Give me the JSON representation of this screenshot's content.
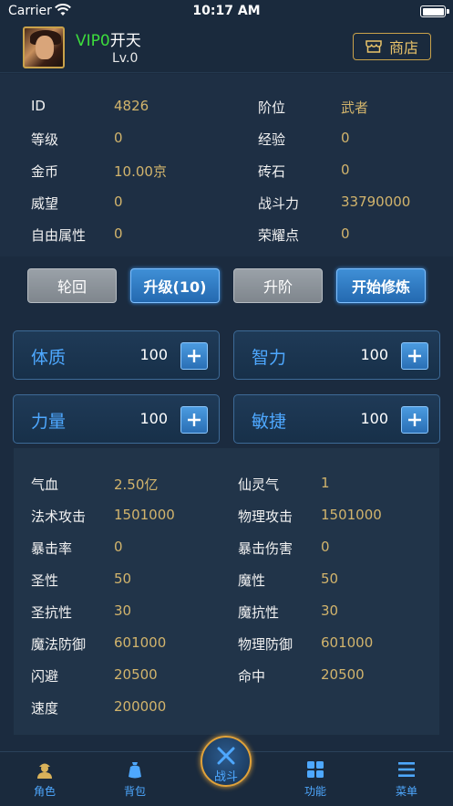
{
  "status_bar": {
    "carrier": "Carrier",
    "time": "10:17 AM"
  },
  "header": {
    "vip_label": "VIP0",
    "player_name": "开天",
    "level": "Lv.0",
    "shop_label": "商店"
  },
  "info": {
    "rows": [
      {
        "left_label": "ID",
        "left_value": "4826",
        "right_label": "阶位",
        "right_value": "武者"
      },
      {
        "left_label": "等级",
        "left_value": "0",
        "right_label": "经验",
        "right_value": "0"
      },
      {
        "left_label": "金币",
        "left_value": "10.00京",
        "right_label": "砖石",
        "right_value": "0"
      },
      {
        "left_label": "威望",
        "left_value": "0",
        "right_label": "战斗力",
        "right_value": "33790000"
      },
      {
        "left_label": "自由属性",
        "left_value": "0",
        "right_label": "荣耀点",
        "right_value": "0"
      }
    ]
  },
  "actions": {
    "reincarnate": "轮回",
    "upgrade": "升级(10)",
    "promote": "升阶",
    "cultivate": "开始修炼"
  },
  "attributes": [
    {
      "name": "体质",
      "value": "100"
    },
    {
      "name": "智力",
      "value": "100"
    },
    {
      "name": "力量",
      "value": "100"
    },
    {
      "name": "敏捷",
      "value": "100"
    }
  ],
  "stats": {
    "rows": [
      {
        "left_label": "气血",
        "left_value": "2.50亿",
        "right_label": "仙灵气",
        "right_value": "1"
      },
      {
        "left_label": "法术攻击",
        "left_value": "1501000",
        "right_label": "物理攻击",
        "right_value": "1501000"
      },
      {
        "left_label": "暴击率",
        "left_value": "0",
        "right_label": "暴击伤害",
        "right_value": "0"
      },
      {
        "left_label": "圣性",
        "left_value": "50",
        "right_label": "魔性",
        "right_value": "50"
      },
      {
        "left_label": "圣抗性",
        "left_value": "30",
        "right_label": "魔抗性",
        "right_value": "30"
      },
      {
        "left_label": "魔法防御",
        "left_value": "601000",
        "right_label": "物理防御",
        "right_value": "601000"
      },
      {
        "left_label": "闪避",
        "left_value": "20500",
        "right_label": "命中",
        "right_value": "20500"
      },
      {
        "left_label": "速度",
        "left_value": "200000",
        "right_label": "",
        "right_value": ""
      }
    ]
  },
  "nav": {
    "role": "角色",
    "bag": "背包",
    "battle": "战斗",
    "function": "功能",
    "menu": "菜单"
  },
  "colors": {
    "accent_blue": "#4ea8ff",
    "gold_value": "#d2b46c",
    "vip_green": "#3ddc3d",
    "background": "#1b2b3f"
  }
}
